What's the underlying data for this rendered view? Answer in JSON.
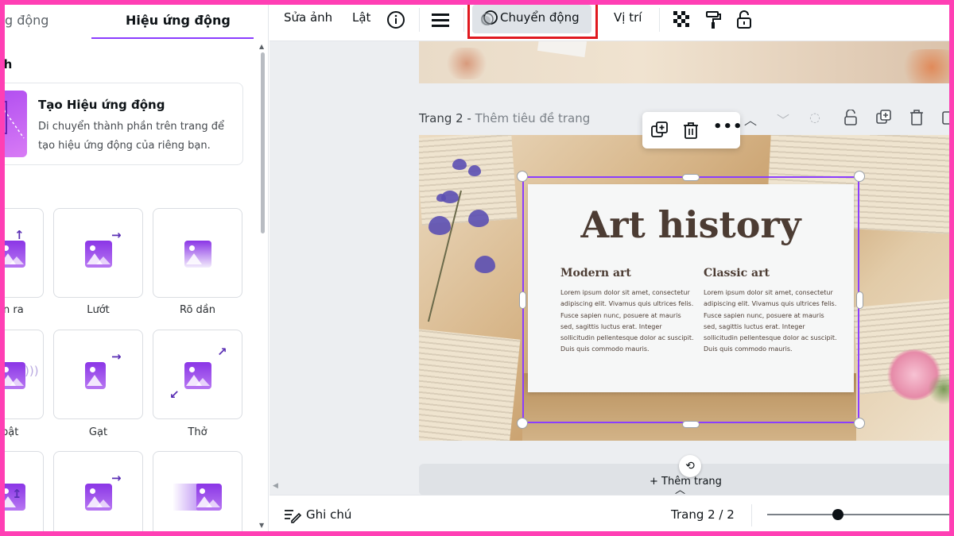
{
  "left_panel": {
    "tab_partial": "ang động",
    "tab_active": "Hiệu ứng động",
    "section_header_partial": "nh",
    "create_card": {
      "title": "Tạo Hiệu ứng động",
      "description": "Di chuyển thành phần trên trang để tạo hiệu ứng động của riêng bạn."
    },
    "effects": [
      {
        "label": "n ra",
        "icon": "rise-icon"
      },
      {
        "label": "Lướt",
        "icon": "pan-icon"
      },
      {
        "label": "Rõ dần",
        "icon": "fade-icon"
      },
      {
        "label": "bật",
        "icon": "pop-icon"
      },
      {
        "label": "Gạt",
        "icon": "wipe-icon"
      },
      {
        "label": "Thở",
        "icon": "breathe-icon"
      }
    ]
  },
  "toolbar": {
    "edit_image": "Sửa ảnh",
    "flip": "Lật",
    "animate": "Chuyển động",
    "position": "Vị trí",
    "active_item": "Chuyển động",
    "highlight_color": "#e0191f"
  },
  "canvas": {
    "page2_label": "Trang 2 - ",
    "page2_title_placeholder": "Thêm tiêu đề trang",
    "design": {
      "title": "Art history",
      "col1_heading": "Modern art",
      "col2_heading": "Classic art",
      "col1_body": "Lorem ipsum dolor sit amet, consectetur adipiscing elit. Vivamus quis ultrices felis. Fusce sapien nunc, posuere at mauris sed, sagittis luctus erat. Integer sollicitudin pellentesque dolor ac suscipit. Duis quis commodo mauris.",
      "col2_body": "Lorem ipsum dolor sit amet, consectetur adipiscing elit. Vivamus quis ultrices felis. Fusce sapien nunc, posuere at mauris sed, sagittis luctus erat. Integer sollicitudin pellentesque dolor ac suscipit. Duis quis commodo mauris."
    },
    "add_page_partial": "+ Thêm trang"
  },
  "bottom_bar": {
    "notes": "Ghi chú",
    "page_indicator": "Trang 2 / 2",
    "zoom_fraction": 0.38
  },
  "colors": {
    "accent": "#8b3dff",
    "frame": "#ff3fb4",
    "design_text": "#4c3c33"
  }
}
